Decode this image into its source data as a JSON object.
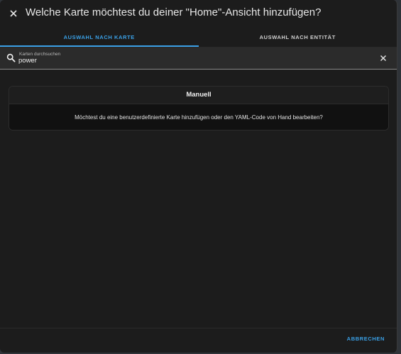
{
  "dialog": {
    "title": "Welche Karte möchtest du deiner \"Home\"-Ansicht hinzufügen?",
    "close_icon": "close-icon"
  },
  "tabs": [
    {
      "label": "AUSWAHL NACH KARTE",
      "active": true
    },
    {
      "label": "AUSWAHL NACH ENTITÄT",
      "active": false
    }
  ],
  "search": {
    "label": "Karten durchsuchen",
    "value": "power",
    "icon": "search-icon",
    "clear_icon": "close-icon"
  },
  "card": {
    "title": "Manuell",
    "body": "Möchtest du eine benutzerdefinierte Karte hinzufügen oder den YAML-Code von Hand bearbeiten?"
  },
  "footer": {
    "cancel_label": "ABBRECHEN"
  },
  "colors": {
    "accent": "#3aa0e6",
    "background": "#1c1c1c",
    "text": "#e6e6e6"
  }
}
